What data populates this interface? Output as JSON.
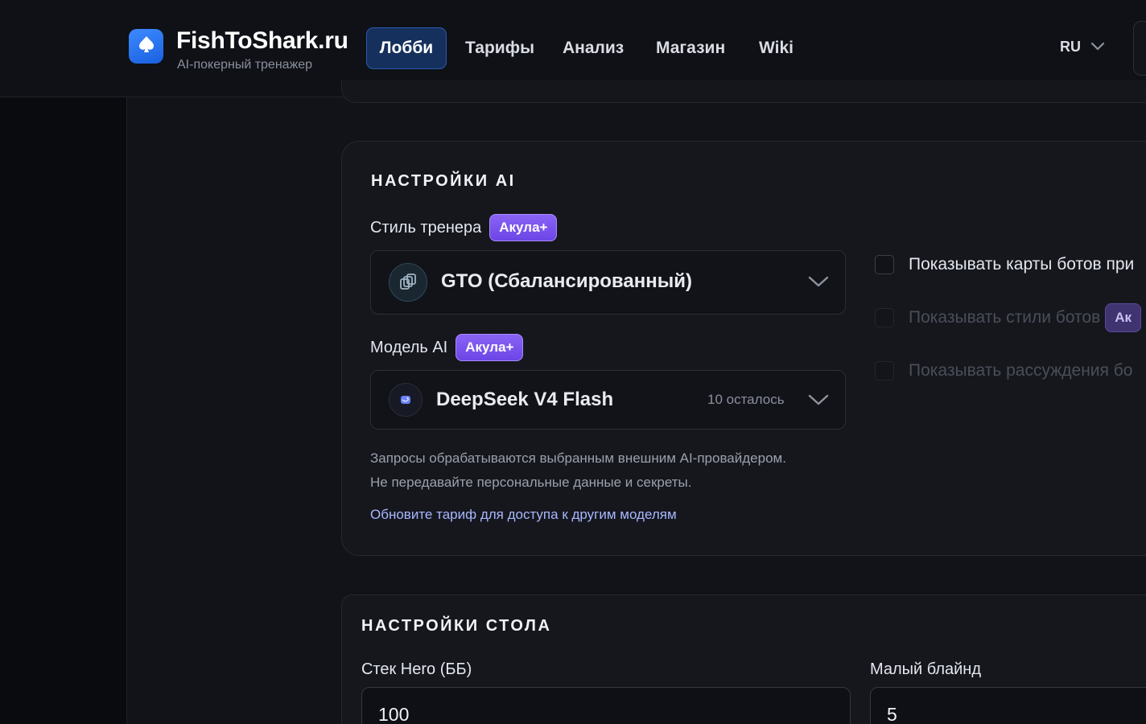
{
  "brand": {
    "name": "FishToShark.ru",
    "subtitle": "AI-покерный тренажер",
    "logo_icon": "spade-icon",
    "accent": "#2f7bf5"
  },
  "nav": {
    "items": [
      {
        "label": "Лобби",
        "active": true
      },
      {
        "label": "Тарифы",
        "active": false
      },
      {
        "label": "Анализ",
        "active": false
      },
      {
        "label": "Магазин",
        "active": false
      },
      {
        "label": "Wiki",
        "active": false
      }
    ],
    "language": "RU"
  },
  "ai_settings": {
    "title": "НАСТРОЙКИ AI",
    "coach_style": {
      "label": "Стиль тренера",
      "badge": "Акула+",
      "value": "GTO (Сбалансированный)",
      "icon": "layers-icon"
    },
    "model": {
      "label": "Модель AI",
      "badge": "Акула+",
      "value": "DeepSeek V4 Flash",
      "remaining": "10 осталось",
      "icon": "whale-icon"
    },
    "note_line1": "Запросы обрабатываются выбранным внешним AI-провайдером.",
    "note_line2": "Не передавайте персональные данные и секреты.",
    "upgrade_link": "Обновите тариф для доступа к другим моделям",
    "options": [
      {
        "label": "Показывать карты ботов при",
        "checked": false,
        "enabled": true
      },
      {
        "label": "Показывать стили ботов",
        "badge": "Ак",
        "checked": false,
        "enabled": false
      },
      {
        "label": "Показывать рассуждения бо",
        "checked": false,
        "enabled": false
      }
    ]
  },
  "table_settings": {
    "title": "НАСТРОЙКИ СТОЛА",
    "hero_stack": {
      "label": "Стек Hero (ББ)",
      "value": "100"
    },
    "small_blind": {
      "label": "Малый блайнд",
      "value": "5"
    }
  },
  "colors": {
    "badge_purple": "#7c55ee",
    "link": "#a8b7ff",
    "active_nav": "#15305c"
  }
}
